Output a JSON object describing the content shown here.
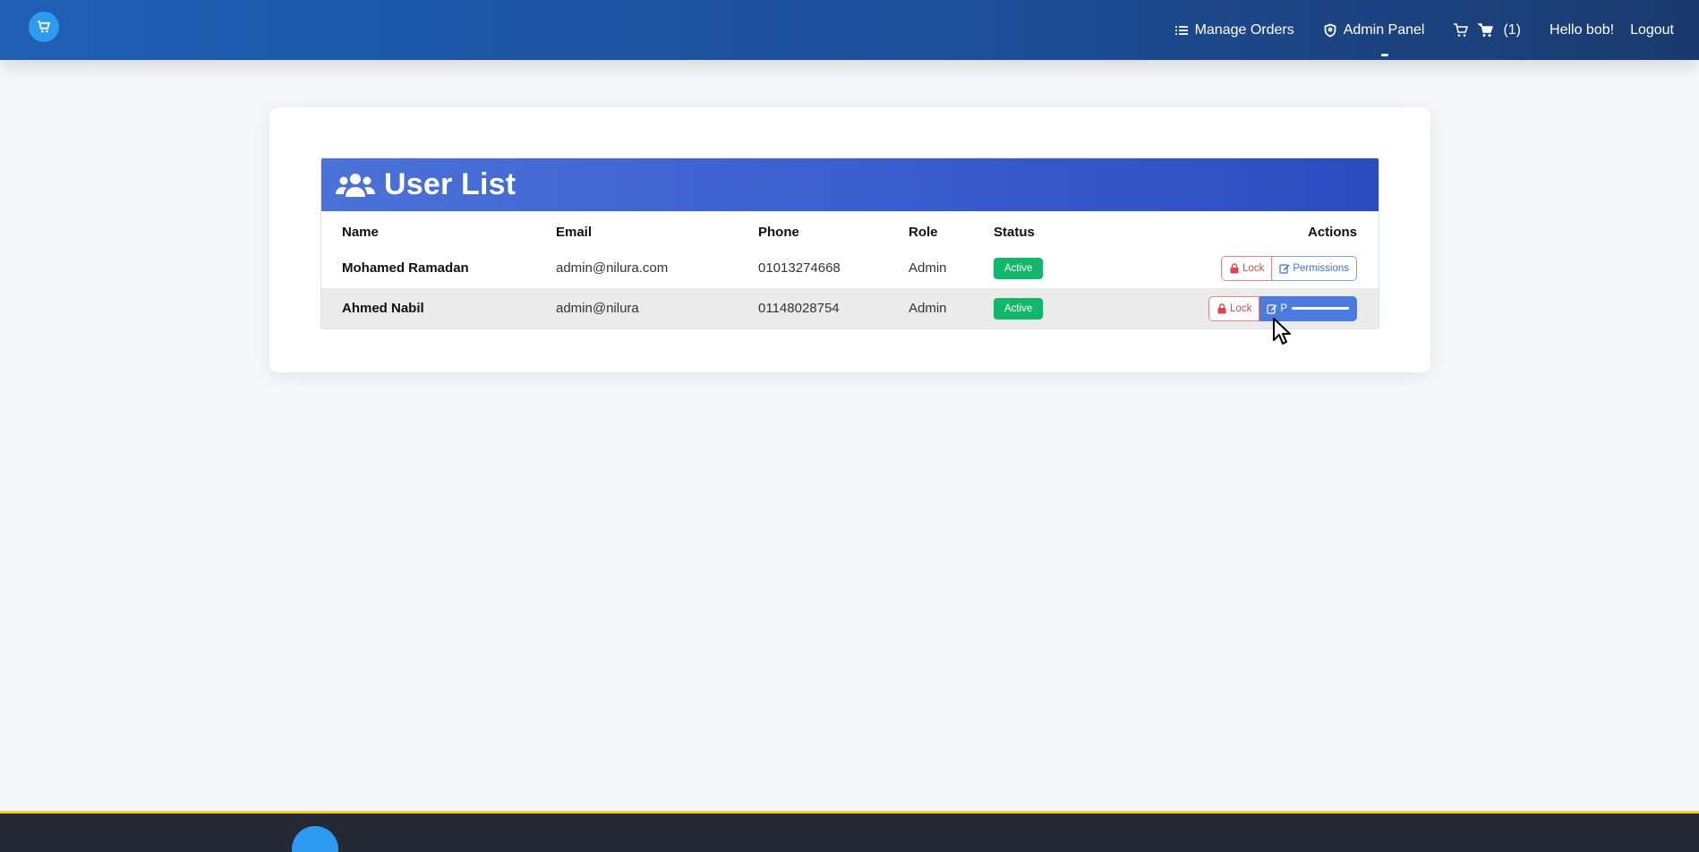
{
  "nav": {
    "manage_orders": "Manage Orders",
    "admin_panel": "Admin Panel",
    "cart_count": "(1)",
    "greeting": "Hello bob!",
    "logout": "Logout"
  },
  "panel": {
    "title": "User List",
    "columns": {
      "name": "Name",
      "email": "Email",
      "phone": "Phone",
      "role": "Role",
      "status": "Status",
      "actions": "Actions"
    },
    "rows": [
      {
        "name": "Mohamed Ramadan",
        "email": "admin@nilura.com",
        "phone": "01013274668",
        "role": "Admin",
        "status": "Active",
        "lock_label": "Lock",
        "permissions_label": "Permissions"
      },
      {
        "name": "Ahmed Nabil",
        "email": "admin@nilura",
        "phone": "01148028754",
        "role": "Admin",
        "status": "Active",
        "lock_label": "Lock",
        "permissions_label": "P"
      }
    ]
  },
  "colors": {
    "navbar": "#1f5fb4",
    "header": "#3a5fcf",
    "active_badge": "#12b76a",
    "lock": "#e0454f",
    "permissions": "#3d6fd6",
    "footer": "#232a35",
    "footer_accent": "#f2d21b"
  },
  "icons": {
    "logo": "shop-logo-icon",
    "manage_orders": "list-icon",
    "admin_panel": "shield-icon",
    "cart": "cart-icon",
    "users": "users-icon",
    "lock": "lock-icon",
    "permissions": "edit-icon"
  }
}
